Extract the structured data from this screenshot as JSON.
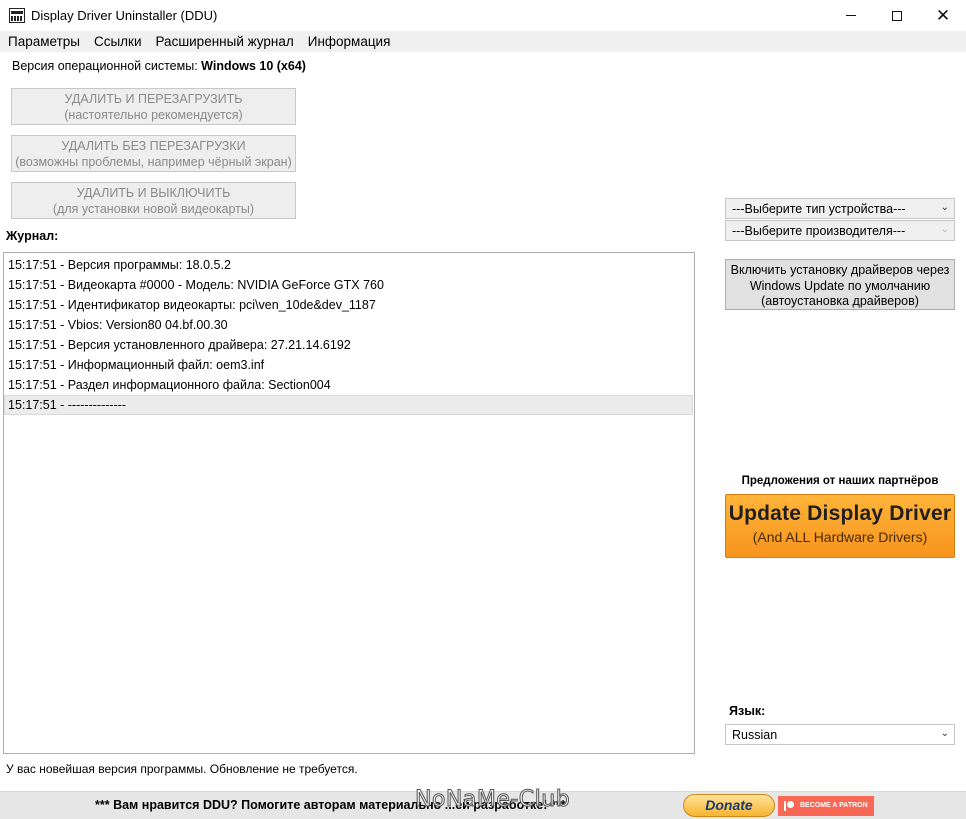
{
  "window": {
    "title": "Display Driver Uninstaller (DDU)",
    "minimize_glyph": "",
    "close_glyph": "✕"
  },
  "menu": [
    "Параметры",
    "Ссылки",
    "Расширенный журнал",
    "Информация"
  ],
  "os": {
    "label": "Версия операционной системы:",
    "value": "Windows 10 (x64)"
  },
  "actions": [
    {
      "line1": "УДАЛИТЬ И ПЕРЕЗАГРУЗИТЬ",
      "line2": "(настоятельно рекомендуется)"
    },
    {
      "line1": "УДАЛИТЬ БЕЗ ПЕРЕЗАГРУЗКИ",
      "line2": "(возможны проблемы, например чёрный экран)"
    },
    {
      "line1": "УДАЛИТЬ И ВЫКЛЮЧИТЬ",
      "line2": "(для установки новой видеокарты)"
    }
  ],
  "journal": {
    "label": "Журнал:",
    "lines": [
      "15:17:51 - Версия программы: 18.0.5.2",
      "15:17:51 - Видеокарта #0000 - Модель: NVIDIA GeForce GTX 760",
      "15:17:51 - Идентификатор видеокарты: pci\\ven_10de&dev_1187",
      "15:17:51 - Vbios: Version80 04.bf.00.30",
      "15:17:51 - Версия установленного драйвера: 27.21.14.6192",
      "15:17:51 - Информационный файл: oem3.inf",
      "15:17:51 - Раздел информационного файла: Section004",
      "15:17:51 - --------------"
    ]
  },
  "right_panel": {
    "device_type": "---Выберите тип устройства---",
    "vendor": "---Выберите производителя---",
    "windows_update_button": {
      "line1": "Включить установку драйверов через",
      "line2": "Windows Update по умолчанию",
      "line3": "(автоустановка драйверов)"
    },
    "partners_label": "Предложения от наших партнёров",
    "banner_title": "Update Display Driver",
    "banner_subtitle": "(And ALL Hardware Drivers)",
    "language_label": "Язык:",
    "language_value": "Russian",
    "dropdown_arrow": "⌄"
  },
  "status": "У вас новейшая версия программы. Обновление не требуется.",
  "donate_bar": {
    "text": "*** Вам нравится DDU? Помогите авторам материально        ...ей разработке! ***",
    "donate_label": "Donate",
    "patron_label": "BECOME A PATRON",
    "watermark": "NoNaMe-Club"
  },
  "colors": {
    "menubar_bg": "#f0f0f0",
    "banner_orange": "#f7941d",
    "patreon": "#f96854"
  }
}
